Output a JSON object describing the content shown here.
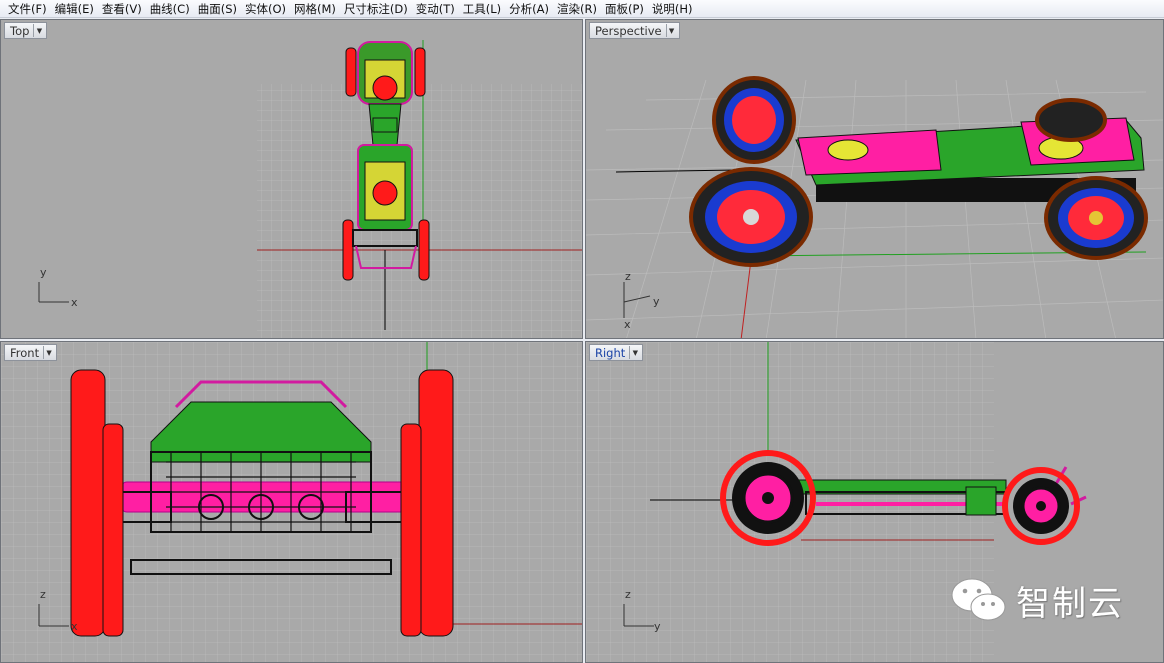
{
  "menu": [
    "文件(F)",
    "编辑(E)",
    "查看(V)",
    "曲线(C)",
    "曲面(S)",
    "实体(O)",
    "网格(M)",
    "尺寸标注(D)",
    "变动(T)",
    "工具(L)",
    "分析(A)",
    "渲染(R)",
    "面板(P)",
    "说明(H)"
  ],
  "viewports": {
    "top": {
      "label": "Top",
      "axes": [
        "y",
        "x"
      ]
    },
    "perspective": {
      "label": "Perspective",
      "axes": [
        "z",
        "y",
        "x"
      ]
    },
    "front": {
      "label": "Front",
      "axes": [
        "z",
        "x"
      ]
    },
    "right": {
      "label": "Right",
      "axes": [
        "z",
        "y"
      ]
    }
  },
  "watermark": {
    "text": "智制云"
  },
  "colors": {
    "viewport_bg": "#a9a9a9",
    "grid": "#bcbcbc",
    "x_axis": "#a02020",
    "y_axis": "#20a020",
    "tire": "#ff1a1a",
    "deck": "#ff1fa3",
    "frame": "#2aa52a"
  }
}
